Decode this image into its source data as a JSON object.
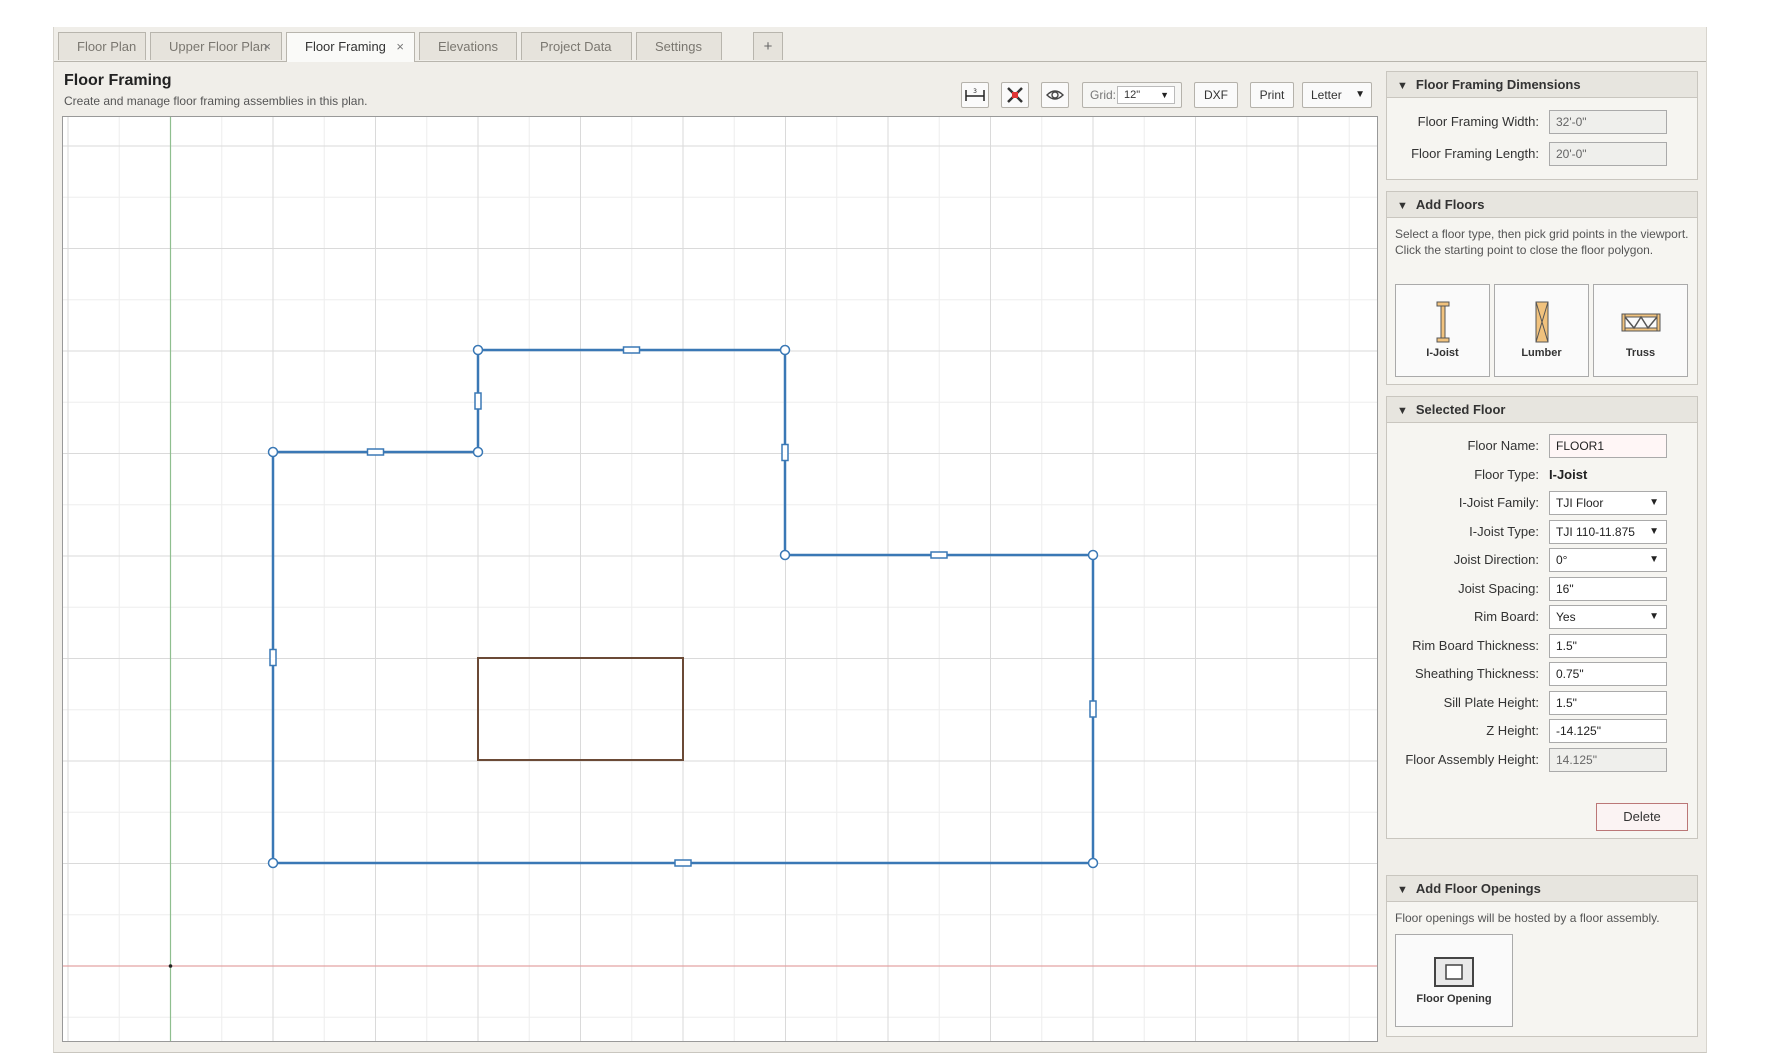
{
  "tabs": [
    {
      "label": "Floor Plan",
      "closable": false,
      "active": false
    },
    {
      "label": "Upper Floor Plan",
      "closable": true,
      "active": false
    },
    {
      "label": "Floor Framing",
      "closable": true,
      "active": true
    },
    {
      "label": "Elevations",
      "closable": false,
      "active": false
    },
    {
      "label": "Project Data",
      "closable": false,
      "active": false
    },
    {
      "label": "Settings",
      "closable": false,
      "active": false
    }
  ],
  "tab_close_glyph": "×",
  "add_tab_label": "+",
  "header": {
    "title": "Floor Framing",
    "subtitle": "Create and manage floor framing assemblies in this plan."
  },
  "toolbar": {
    "dimension_icon": "dimension-icon",
    "snap_icon": "snap-icon",
    "visibility_icon": "eye-icon",
    "grid_label": "Grid:",
    "grid_value": "12\"",
    "dxf_label": "DXF",
    "print_label": "Print",
    "paper_value": "Letter"
  },
  "colors": {
    "outline": "#3a78b5",
    "opening": "#6b4a36",
    "grid_minor": "#eeeeee",
    "grid_major": "#dadada",
    "axis_y": "#8fbf8f",
    "axis_x": "#e3a3a3"
  },
  "framing_dimensions": {
    "title": "Floor Framing Dimensions",
    "width_label": "Floor Framing Width:",
    "width_value": "32'-0\"",
    "length_label": "Floor Framing Length:",
    "length_value": "20'-0\""
  },
  "add_floors": {
    "title": "Add Floors",
    "help": "Select a floor type, then pick grid points in the viewport. Click the starting point to close the floor polygon.",
    "types": [
      {
        "label": "I-Joist",
        "icon": "i-joist-icon"
      },
      {
        "label": "Lumber",
        "icon": "lumber-icon"
      },
      {
        "label": "Truss",
        "icon": "truss-icon"
      }
    ]
  },
  "selected_floor": {
    "title": "Selected Floor",
    "name_label": "Floor Name:",
    "name_value": "FLOOR1",
    "type_label": "Floor Type:",
    "type_value": "I-Joist",
    "family_label": "I-Joist Family:",
    "family_value": "TJI Floor",
    "ijoist_type_label": "I-Joist Type:",
    "ijoist_type_value": "TJI 110-11.875",
    "direction_label": "Joist Direction:",
    "direction_value": "0°",
    "spacing_label": "Joist Spacing:",
    "spacing_value": "16\"",
    "rim_label": "Rim Board:",
    "rim_value": "Yes",
    "rim_thickness_label": "Rim Board Thickness:",
    "rim_thickness_value": "1.5\"",
    "sheathing_label": "Sheathing Thickness:",
    "sheathing_value": "0.75\"",
    "sill_label": "Sill Plate Height:",
    "sill_value": "1.5\"",
    "z_label": "Z Height:",
    "z_value": "-14.125\"",
    "assembly_label": "Floor Assembly Height:",
    "assembly_value": "14.125\"",
    "delete_label": "Delete"
  },
  "floor_openings": {
    "title": "Add Floor Openings",
    "help": "Floor openings will be hosted by a floor assembly.",
    "button_label": "Floor Opening",
    "button_icon": "floor-opening-icon"
  },
  "panel_toggle_glyph": "▼",
  "dropdown_caret": "▼"
}
